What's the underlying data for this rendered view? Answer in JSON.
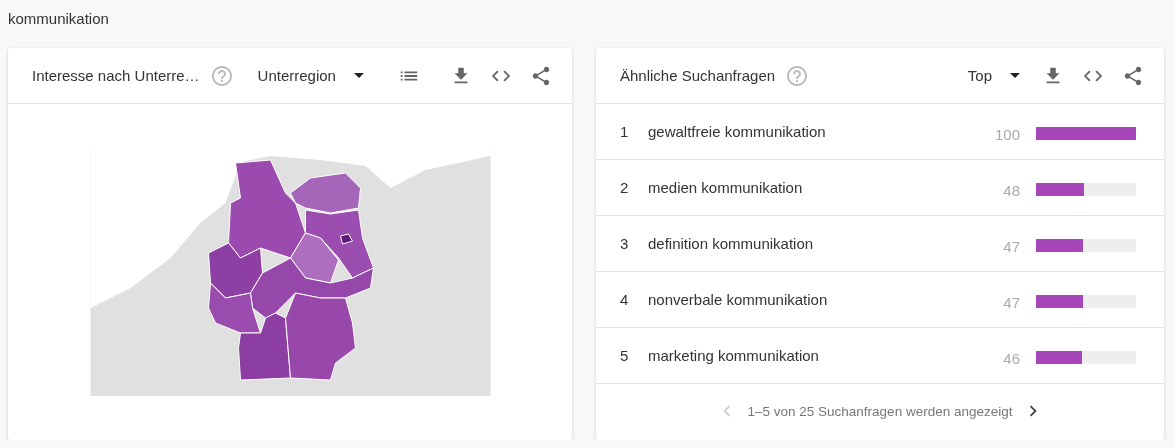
{
  "page_title": "kommunikation",
  "region_card": {
    "title": "Interesse nach Unterre…",
    "resolution": "Unterregion"
  },
  "queries_card": {
    "title": "Ähnliche Suchanfragen",
    "sort": "Top",
    "rows": [
      {
        "rank": "1",
        "query": "gewaltfreie kommunikation",
        "value": "100",
        "level": 1.0
      },
      {
        "rank": "2",
        "query": "medien kommunikation",
        "value": "48",
        "level": 0.48
      },
      {
        "rank": "3",
        "query": "definition kommunikation",
        "value": "47",
        "level": 0.47
      },
      {
        "rank": "4",
        "query": "nonverbale kommunikation",
        "value": "47",
        "level": 0.47
      },
      {
        "rank": "5",
        "query": "marketing kommunikation",
        "value": "46",
        "level": 0.46
      }
    ],
    "pager": {
      "text": "1–5 von 25 Suchanfragen werden angezeigt",
      "prev_disabled": true,
      "next_disabled": false
    }
  }
}
